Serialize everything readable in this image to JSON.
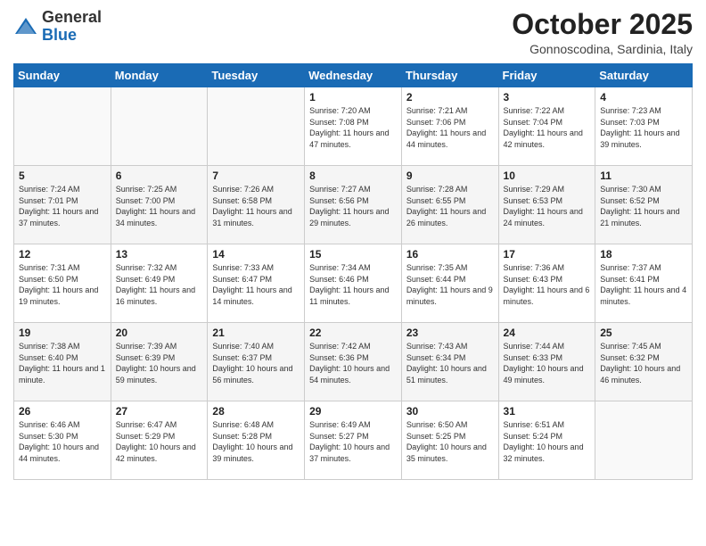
{
  "header": {
    "logo_general": "General",
    "logo_blue": "Blue",
    "month_title": "October 2025",
    "location": "Gonnoscodina, Sardinia, Italy"
  },
  "days_of_week": [
    "Sunday",
    "Monday",
    "Tuesday",
    "Wednesday",
    "Thursday",
    "Friday",
    "Saturday"
  ],
  "weeks": [
    [
      {
        "day": "",
        "info": ""
      },
      {
        "day": "",
        "info": ""
      },
      {
        "day": "",
        "info": ""
      },
      {
        "day": "1",
        "info": "Sunrise: 7:20 AM\nSunset: 7:08 PM\nDaylight: 11 hours and 47 minutes."
      },
      {
        "day": "2",
        "info": "Sunrise: 7:21 AM\nSunset: 7:06 PM\nDaylight: 11 hours and 44 minutes."
      },
      {
        "day": "3",
        "info": "Sunrise: 7:22 AM\nSunset: 7:04 PM\nDaylight: 11 hours and 42 minutes."
      },
      {
        "day": "4",
        "info": "Sunrise: 7:23 AM\nSunset: 7:03 PM\nDaylight: 11 hours and 39 minutes."
      }
    ],
    [
      {
        "day": "5",
        "info": "Sunrise: 7:24 AM\nSunset: 7:01 PM\nDaylight: 11 hours and 37 minutes."
      },
      {
        "day": "6",
        "info": "Sunrise: 7:25 AM\nSunset: 7:00 PM\nDaylight: 11 hours and 34 minutes."
      },
      {
        "day": "7",
        "info": "Sunrise: 7:26 AM\nSunset: 6:58 PM\nDaylight: 11 hours and 31 minutes."
      },
      {
        "day": "8",
        "info": "Sunrise: 7:27 AM\nSunset: 6:56 PM\nDaylight: 11 hours and 29 minutes."
      },
      {
        "day": "9",
        "info": "Sunrise: 7:28 AM\nSunset: 6:55 PM\nDaylight: 11 hours and 26 minutes."
      },
      {
        "day": "10",
        "info": "Sunrise: 7:29 AM\nSunset: 6:53 PM\nDaylight: 11 hours and 24 minutes."
      },
      {
        "day": "11",
        "info": "Sunrise: 7:30 AM\nSunset: 6:52 PM\nDaylight: 11 hours and 21 minutes."
      }
    ],
    [
      {
        "day": "12",
        "info": "Sunrise: 7:31 AM\nSunset: 6:50 PM\nDaylight: 11 hours and 19 minutes."
      },
      {
        "day": "13",
        "info": "Sunrise: 7:32 AM\nSunset: 6:49 PM\nDaylight: 11 hours and 16 minutes."
      },
      {
        "day": "14",
        "info": "Sunrise: 7:33 AM\nSunset: 6:47 PM\nDaylight: 11 hours and 14 minutes."
      },
      {
        "day": "15",
        "info": "Sunrise: 7:34 AM\nSunset: 6:46 PM\nDaylight: 11 hours and 11 minutes."
      },
      {
        "day": "16",
        "info": "Sunrise: 7:35 AM\nSunset: 6:44 PM\nDaylight: 11 hours and 9 minutes."
      },
      {
        "day": "17",
        "info": "Sunrise: 7:36 AM\nSunset: 6:43 PM\nDaylight: 11 hours and 6 minutes."
      },
      {
        "day": "18",
        "info": "Sunrise: 7:37 AM\nSunset: 6:41 PM\nDaylight: 11 hours and 4 minutes."
      }
    ],
    [
      {
        "day": "19",
        "info": "Sunrise: 7:38 AM\nSunset: 6:40 PM\nDaylight: 11 hours and 1 minute."
      },
      {
        "day": "20",
        "info": "Sunrise: 7:39 AM\nSunset: 6:39 PM\nDaylight: 10 hours and 59 minutes."
      },
      {
        "day": "21",
        "info": "Sunrise: 7:40 AM\nSunset: 6:37 PM\nDaylight: 10 hours and 56 minutes."
      },
      {
        "day": "22",
        "info": "Sunrise: 7:42 AM\nSunset: 6:36 PM\nDaylight: 10 hours and 54 minutes."
      },
      {
        "day": "23",
        "info": "Sunrise: 7:43 AM\nSunset: 6:34 PM\nDaylight: 10 hours and 51 minutes."
      },
      {
        "day": "24",
        "info": "Sunrise: 7:44 AM\nSunset: 6:33 PM\nDaylight: 10 hours and 49 minutes."
      },
      {
        "day": "25",
        "info": "Sunrise: 7:45 AM\nSunset: 6:32 PM\nDaylight: 10 hours and 46 minutes."
      }
    ],
    [
      {
        "day": "26",
        "info": "Sunrise: 6:46 AM\nSunset: 5:30 PM\nDaylight: 10 hours and 44 minutes."
      },
      {
        "day": "27",
        "info": "Sunrise: 6:47 AM\nSunset: 5:29 PM\nDaylight: 10 hours and 42 minutes."
      },
      {
        "day": "28",
        "info": "Sunrise: 6:48 AM\nSunset: 5:28 PM\nDaylight: 10 hours and 39 minutes."
      },
      {
        "day": "29",
        "info": "Sunrise: 6:49 AM\nSunset: 5:27 PM\nDaylight: 10 hours and 37 minutes."
      },
      {
        "day": "30",
        "info": "Sunrise: 6:50 AM\nSunset: 5:25 PM\nDaylight: 10 hours and 35 minutes."
      },
      {
        "day": "31",
        "info": "Sunrise: 6:51 AM\nSunset: 5:24 PM\nDaylight: 10 hours and 32 minutes."
      },
      {
        "day": "",
        "info": ""
      }
    ]
  ]
}
